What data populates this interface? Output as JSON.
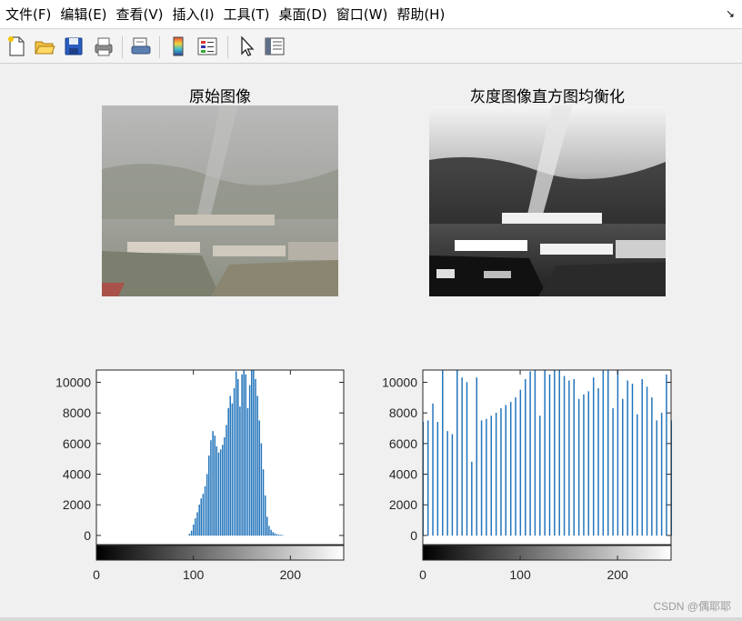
{
  "menu": {
    "items": [
      "文件(F)",
      "编辑(E)",
      "查看(V)",
      "插入(I)",
      "工具(T)",
      "桌面(D)",
      "窗口(W)",
      "帮助(H)"
    ],
    "dock_arrow": "↘"
  },
  "toolbar": {
    "icons": [
      "new-figure-icon",
      "open-file-icon",
      "save-icon",
      "print-icon",
      "print-preview-icon",
      "colorbar-icon",
      "legend-icon",
      "pointer-icon",
      "property-editor-icon"
    ]
  },
  "subplots": {
    "original_title": "原始图像",
    "equalized_title": "灰度图像直方图均衡化"
  },
  "chart_data": [
    {
      "type": "bar",
      "description": "imhist of original grayscale image",
      "xlim": [
        0,
        255
      ],
      "ylim": [
        -600,
        10800
      ],
      "xticks": [
        0,
        100,
        200
      ],
      "yticks": [
        0,
        2000,
        4000,
        6000,
        8000,
        10000
      ],
      "x": [
        96,
        98,
        100,
        102,
        104,
        106,
        108,
        110,
        112,
        114,
        116,
        118,
        120,
        122,
        124,
        126,
        128,
        130,
        132,
        134,
        136,
        138,
        140,
        142,
        144,
        146,
        148,
        150,
        152,
        154,
        156,
        158,
        160,
        162,
        164,
        166,
        168,
        170,
        172,
        174,
        176,
        178,
        180,
        182,
        184,
        186,
        188,
        190,
        192
      ],
      "values": [
        100,
        300,
        700,
        1100,
        1500,
        2000,
        2400,
        2700,
        3200,
        4000,
        5200,
        6200,
        6800,
        6500,
        5800,
        5400,
        5600,
        5900,
        6400,
        7200,
        8300,
        9100,
        8600,
        9600,
        10700,
        10200,
        8400,
        10500,
        10800,
        10500,
        8300,
        9800,
        10800,
        10800,
        10200,
        9100,
        7500,
        6000,
        4300,
        2600,
        1200,
        600,
        350,
        200,
        120,
        70,
        40,
        20,
        10
      ]
    },
    {
      "type": "bar",
      "description": "imhist of histogram-equalized image",
      "xlim": [
        0,
        255
      ],
      "ylim": [
        -600,
        10800
      ],
      "xticks": [
        0,
        100,
        200
      ],
      "yticks": [
        0,
        2000,
        4000,
        6000,
        8000,
        10000
      ],
      "x": [
        0,
        5,
        10,
        15,
        20,
        25,
        30,
        35,
        40,
        45,
        50,
        55,
        60,
        65,
        70,
        75,
        80,
        85,
        90,
        95,
        100,
        105,
        110,
        115,
        120,
        125,
        130,
        135,
        140,
        145,
        150,
        155,
        160,
        165,
        170,
        175,
        180,
        185,
        190,
        195,
        200,
        205,
        210,
        215,
        220,
        225,
        230,
        235,
        240,
        245,
        250,
        255
      ],
      "values": [
        7400,
        7500,
        8600,
        7400,
        10800,
        6800,
        6600,
        10800,
        10300,
        10000,
        4800,
        10300,
        7500,
        7600,
        7800,
        8000,
        8300,
        8500,
        8700,
        9000,
        9500,
        10200,
        10700,
        10800,
        7800,
        10800,
        10500,
        10800,
        10800,
        10400,
        10100,
        10200,
        8900,
        9200,
        9400,
        10300,
        9600,
        10800,
        10800,
        8300,
        10800,
        8900,
        10100,
        9900,
        7900,
        10200,
        9700,
        9000,
        7500,
        8000,
        10500,
        7500
      ]
    }
  ],
  "watermark": "CSDN @偶耶耶"
}
